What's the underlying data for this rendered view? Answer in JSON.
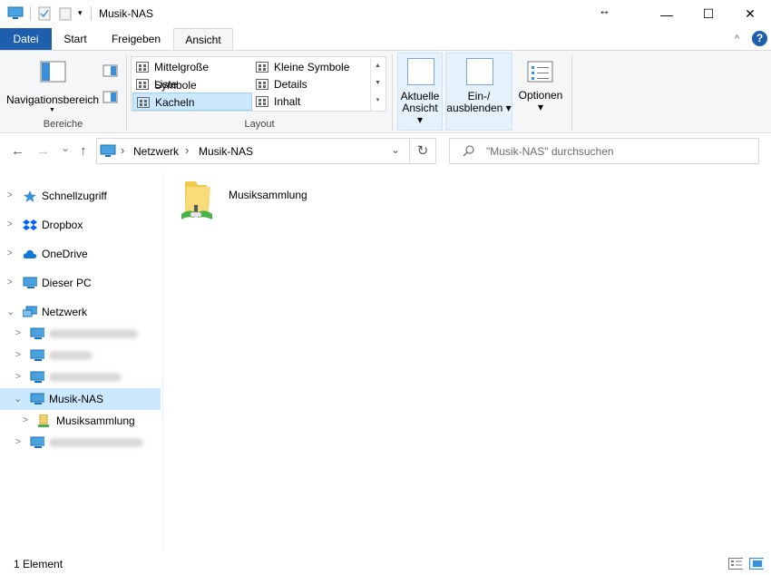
{
  "window": {
    "title": "Musik-NAS",
    "resize_glyph": "↔",
    "minimize": "—",
    "maximize": "☐",
    "close": "✕"
  },
  "ribbon_tabs": [
    {
      "label": "Datei"
    },
    {
      "label": "Start"
    },
    {
      "label": "Freigeben"
    },
    {
      "label": "Ansicht"
    }
  ],
  "ribbon_collapse": "^",
  "help": "?",
  "ribbon": {
    "bereiche": {
      "label": "Bereiche",
      "nav_pane": "Navigationsbereich",
      "dropdown": "▼"
    },
    "layout": {
      "label": "Layout",
      "items": [
        {
          "label": "Mittelgroße Symbole"
        },
        {
          "label": "Kleine Symbole"
        },
        {
          "label": "Liste"
        },
        {
          "label": "Details"
        },
        {
          "label": "Kacheln",
          "selected": true
        },
        {
          "label": "Inhalt"
        }
      ],
      "scroll_up": "▲",
      "scroll_down": "▼",
      "more": "▾"
    },
    "aktuelle_ansicht": {
      "line1": "Aktuelle",
      "line2": "Ansicht ▾"
    },
    "ein_ausblenden": {
      "line1": "Ein-/",
      "line2": "ausblenden ▾"
    },
    "optionen": {
      "line1": "Optionen",
      "line2": "▾"
    }
  },
  "nav": {
    "back": "←",
    "forward": "→",
    "recent": "⌄",
    "up": "↑",
    "breadcrumb": [
      "Netzwerk",
      "Musik-NAS"
    ],
    "separator": "›",
    "refresh": "↻",
    "dropdown": "⌄",
    "search_placeholder": "\"Musik-NAS\" durchsuchen"
  },
  "tree": [
    {
      "label": "Schnellzugriff",
      "icon": "star-icon"
    },
    {
      "label": "Dropbox",
      "icon": "dropbox-icon"
    },
    {
      "label": "OneDrive",
      "icon": "cloud-icon"
    },
    {
      "label": "Dieser PC",
      "icon": "computer-icon"
    },
    {
      "label": "Netzwerk",
      "icon": "network-icon"
    },
    {
      "label": "Musik-NAS",
      "icon": "computer-icon"
    },
    {
      "label": "Musiksammlung",
      "icon": "network-share-icon"
    }
  ],
  "content": {
    "items": [
      {
        "label": "Musiksammlung",
        "icon": "network-folder-icon"
      }
    ]
  },
  "status": {
    "count": "1 Element"
  },
  "colors": {
    "accent": "#1e5fad",
    "selection": "#cce8ff",
    "ribbon_bg": "#f5f6f7"
  }
}
